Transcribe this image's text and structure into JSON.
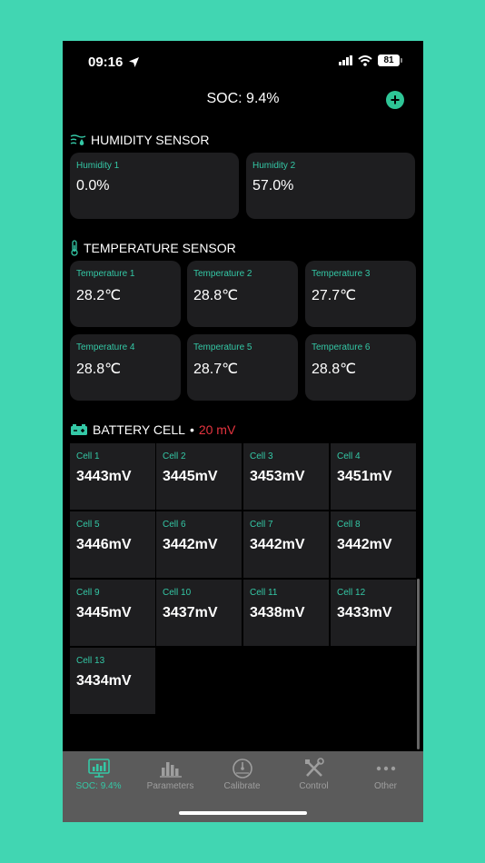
{
  "status_bar": {
    "time": "09:16",
    "battery": "81"
  },
  "header": {
    "title": "SOC: 9.4%",
    "add_label": "+"
  },
  "humidity": {
    "title": "HUMIDITY SENSOR",
    "items": [
      {
        "label": "Humidity 1",
        "value": "0.0%"
      },
      {
        "label": "Humidity 2",
        "value": "57.0%"
      }
    ]
  },
  "temperature": {
    "title": "TEMPERATURE SENSOR",
    "items": [
      {
        "label": "Temperature 1",
        "value": "28.2℃"
      },
      {
        "label": "Temperature 2",
        "value": "28.8℃"
      },
      {
        "label": "Temperature 3",
        "value": "27.7℃"
      },
      {
        "label": "Temperature 4",
        "value": "28.8℃"
      },
      {
        "label": "Temperature 5",
        "value": "28.7℃"
      },
      {
        "label": "Temperature 6",
        "value": "28.8℃"
      }
    ]
  },
  "battery_cell": {
    "title": "BATTERY CELL",
    "separator": "•",
    "delta": "20 mV",
    "cells": [
      {
        "label": "Cell 1",
        "value": "3443mV"
      },
      {
        "label": "Cell 2",
        "value": "3445mV"
      },
      {
        "label": "Cell 3",
        "value": "3453mV"
      },
      {
        "label": "Cell 4",
        "value": "3451mV"
      },
      {
        "label": "Cell 5",
        "value": "3446mV"
      },
      {
        "label": "Cell 6",
        "value": "3442mV"
      },
      {
        "label": "Cell 7",
        "value": "3442mV"
      },
      {
        "label": "Cell 8",
        "value": "3442mV"
      },
      {
        "label": "Cell 9",
        "value": "3445mV"
      },
      {
        "label": "Cell 10",
        "value": "3437mV"
      },
      {
        "label": "Cell 11",
        "value": "3438mV"
      },
      {
        "label": "Cell 12",
        "value": "3433mV"
      },
      {
        "label": "Cell 13",
        "value": "3434mV"
      }
    ]
  },
  "tabbar": {
    "tabs": [
      {
        "label": "SOC: 9.4%",
        "icon": "monitor-chart-icon",
        "active": true
      },
      {
        "label": "Parameters",
        "icon": "bar-chart-icon",
        "active": false
      },
      {
        "label": "Calibrate",
        "icon": "gauge-icon",
        "active": false
      },
      {
        "label": "Control",
        "icon": "tools-icon",
        "active": false
      },
      {
        "label": "Other",
        "icon": "more-dots-icon",
        "active": false
      }
    ]
  },
  "colors": {
    "accent": "#34c8a6",
    "alert": "#e5343f",
    "background": "#41d6b2",
    "card": "#1e1e20"
  }
}
